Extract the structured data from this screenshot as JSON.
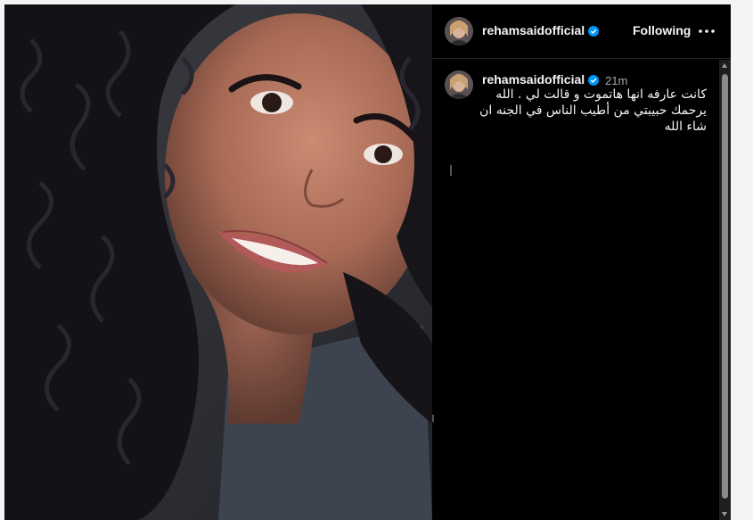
{
  "post": {
    "author": {
      "username": "rehamsaidofficial",
      "verified": true,
      "verified_color": "#0095f6"
    },
    "header": {
      "following_label": "Following",
      "more_icon": "more-horizontal-icon"
    },
    "comment": {
      "username": "rehamsaidofficial",
      "time_ago": "21m",
      "caption_lines": [
        "كانت عارفه انها هاتموت و قالت لي . الله",
        "يرحمك حبيبتي من أطيب الناس في الجنه ان",
        "شاء الله"
      ]
    },
    "photo": {
      "subject": "selfie of smiling woman with curly dark hair"
    }
  },
  "colors": {
    "background": "#000000",
    "text": "#f5f5f5",
    "muted": "#a8a8a8",
    "divider": "#262626"
  }
}
